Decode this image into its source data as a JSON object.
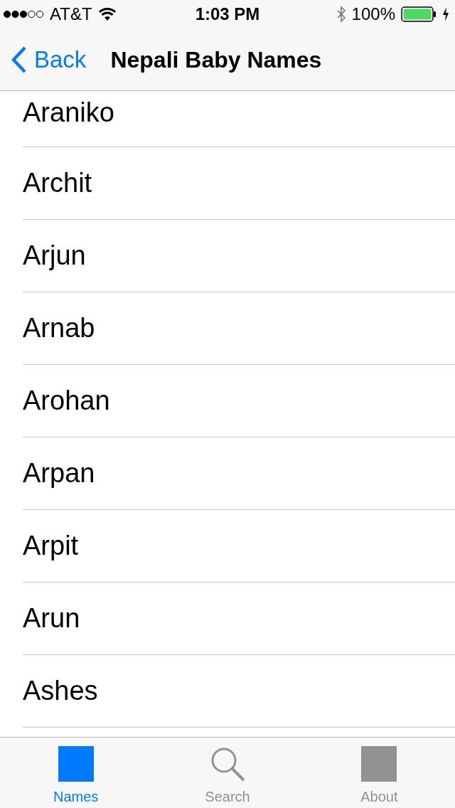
{
  "status_bar": {
    "carrier": "AT&T",
    "time": "1:03 PM",
    "battery": "100%"
  },
  "nav_bar": {
    "back": "Back",
    "title": "Nepali Baby Names"
  },
  "names": [
    {
      "name": "Araniko"
    },
    {
      "name": "Archit"
    },
    {
      "name": "Arjun"
    },
    {
      "name": "Arnab"
    },
    {
      "name": "Arohan"
    },
    {
      "name": "Arpan"
    },
    {
      "name": "Arpit"
    },
    {
      "name": "Arun"
    },
    {
      "name": "Ashes"
    }
  ],
  "tabs": [
    {
      "label": "Names",
      "kind": "square",
      "selected": true
    },
    {
      "label": "Search",
      "kind": "search",
      "selected": false
    },
    {
      "label": "About",
      "kind": "square",
      "selected": false
    }
  ]
}
